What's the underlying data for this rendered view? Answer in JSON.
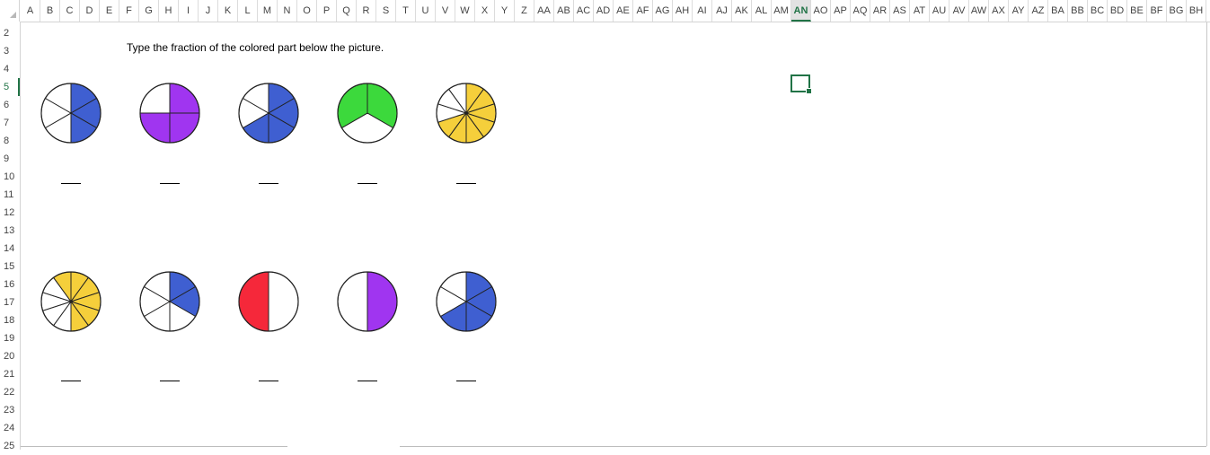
{
  "columns": [
    "A",
    "B",
    "C",
    "D",
    "E",
    "F",
    "G",
    "H",
    "I",
    "J",
    "K",
    "L",
    "M",
    "N",
    "O",
    "P",
    "Q",
    "R",
    "S",
    "T",
    "U",
    "V",
    "W",
    "X",
    "Y",
    "Z",
    "AA",
    "AB",
    "AC",
    "AD",
    "AE",
    "AF",
    "AG",
    "AH",
    "AI",
    "AJ",
    "AK",
    "AL",
    "AM",
    "AN",
    "AO",
    "AP",
    "AQ",
    "AR",
    "AS",
    "AT",
    "AU",
    "AV",
    "AW",
    "AX",
    "AY",
    "AZ",
    "BA",
    "BB",
    "BC",
    "BD",
    "BE",
    "BF",
    "BG",
    "BH"
  ],
  "selected_column": "AN",
  "rows": [
    "2",
    "3",
    "4",
    "5",
    "6",
    "7",
    "8",
    "9",
    "10",
    "11",
    "12",
    "13",
    "14",
    "15",
    "16",
    "17",
    "18",
    "19",
    "20",
    "21",
    "22",
    "23",
    "24",
    "25"
  ],
  "selected_row": "5",
  "instruction": "Type the fraction of the colored part below the picture.",
  "answer_blank": "___",
  "colors": {
    "blue": "#3f5fd1",
    "purple": "#a035f0",
    "green": "#3cd93c",
    "yellow": "#f5cf3b",
    "red": "#f5283a",
    "selection": "#217346"
  },
  "pies": [
    {
      "row": 1,
      "index": 1,
      "color": "blue",
      "slices": 6,
      "colored": [
        0,
        1,
        2
      ]
    },
    {
      "row": 1,
      "index": 2,
      "color": "purple",
      "slices": 4,
      "colored": [
        0,
        1,
        2
      ]
    },
    {
      "row": 1,
      "index": 3,
      "color": "blue",
      "slices": 6,
      "colored": [
        0,
        1,
        2,
        3
      ]
    },
    {
      "row": 1,
      "index": 4,
      "color": "green",
      "slices": 3,
      "colored": [
        0,
        2
      ]
    },
    {
      "row": 1,
      "index": 5,
      "color": "yellow",
      "slices": 10,
      "colored": [
        0,
        1,
        2,
        3,
        4,
        5,
        6
      ]
    },
    {
      "row": 2,
      "index": 1,
      "color": "yellow",
      "slices": 10,
      "colored": [
        0,
        1,
        2,
        3,
        4,
        9
      ]
    },
    {
      "row": 2,
      "index": 2,
      "color": "blue",
      "slices": 6,
      "colored": [
        0,
        1
      ]
    },
    {
      "row": 2,
      "index": 3,
      "color": "red",
      "slices": 2,
      "colored": [
        1
      ]
    },
    {
      "row": 2,
      "index": 4,
      "color": "purple",
      "slices": 2,
      "colored": [
        0
      ]
    },
    {
      "row": 2,
      "index": 5,
      "color": "blue",
      "slices": 6,
      "colored": [
        0,
        1,
        2,
        3
      ]
    }
  ]
}
